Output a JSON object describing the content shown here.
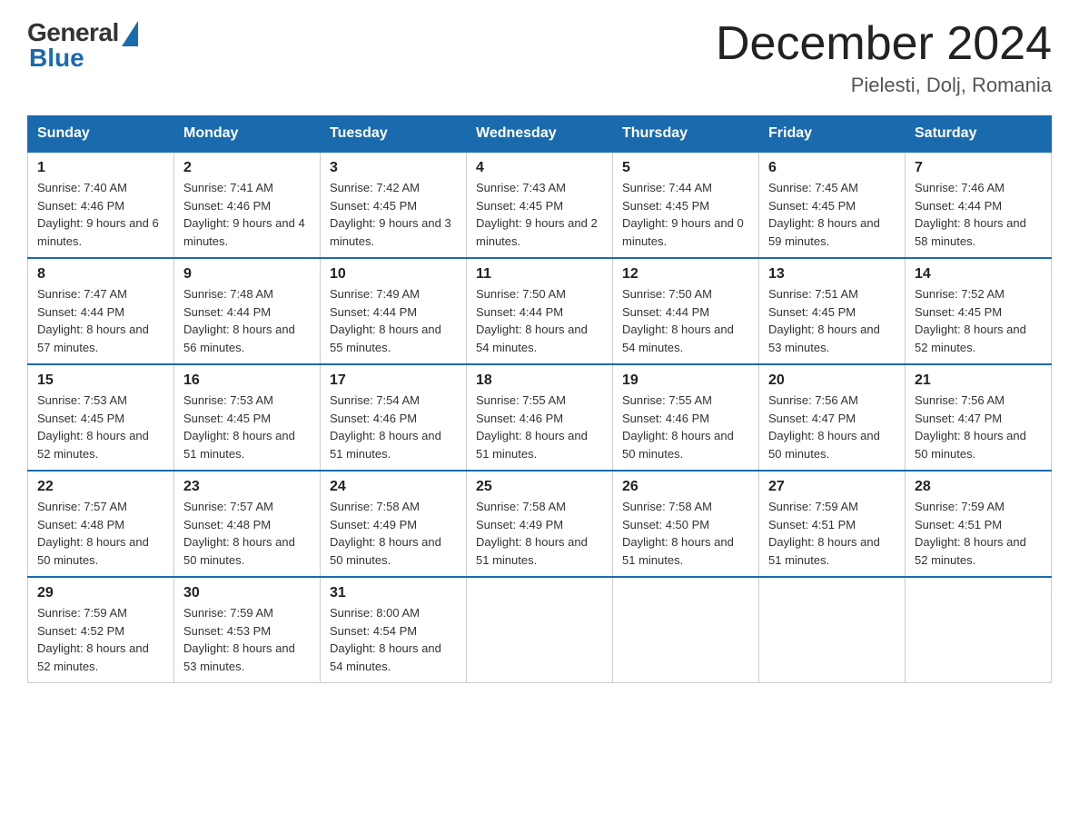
{
  "logo": {
    "general": "General",
    "blue": "Blue"
  },
  "title": "December 2024",
  "subtitle": "Pielesti, Dolj, Romania",
  "days_of_week": [
    "Sunday",
    "Monday",
    "Tuesday",
    "Wednesday",
    "Thursday",
    "Friday",
    "Saturday"
  ],
  "weeks": [
    [
      {
        "day": "1",
        "sunrise": "7:40 AM",
        "sunset": "4:46 PM",
        "daylight": "9 hours and 6 minutes."
      },
      {
        "day": "2",
        "sunrise": "7:41 AM",
        "sunset": "4:46 PM",
        "daylight": "9 hours and 4 minutes."
      },
      {
        "day": "3",
        "sunrise": "7:42 AM",
        "sunset": "4:45 PM",
        "daylight": "9 hours and 3 minutes."
      },
      {
        "day": "4",
        "sunrise": "7:43 AM",
        "sunset": "4:45 PM",
        "daylight": "9 hours and 2 minutes."
      },
      {
        "day": "5",
        "sunrise": "7:44 AM",
        "sunset": "4:45 PM",
        "daylight": "9 hours and 0 minutes."
      },
      {
        "day": "6",
        "sunrise": "7:45 AM",
        "sunset": "4:45 PM",
        "daylight": "8 hours and 59 minutes."
      },
      {
        "day": "7",
        "sunrise": "7:46 AM",
        "sunset": "4:44 PM",
        "daylight": "8 hours and 58 minutes."
      }
    ],
    [
      {
        "day": "8",
        "sunrise": "7:47 AM",
        "sunset": "4:44 PM",
        "daylight": "8 hours and 57 minutes."
      },
      {
        "day": "9",
        "sunrise": "7:48 AM",
        "sunset": "4:44 PM",
        "daylight": "8 hours and 56 minutes."
      },
      {
        "day": "10",
        "sunrise": "7:49 AM",
        "sunset": "4:44 PM",
        "daylight": "8 hours and 55 minutes."
      },
      {
        "day": "11",
        "sunrise": "7:50 AM",
        "sunset": "4:44 PM",
        "daylight": "8 hours and 54 minutes."
      },
      {
        "day": "12",
        "sunrise": "7:50 AM",
        "sunset": "4:44 PM",
        "daylight": "8 hours and 54 minutes."
      },
      {
        "day": "13",
        "sunrise": "7:51 AM",
        "sunset": "4:45 PM",
        "daylight": "8 hours and 53 minutes."
      },
      {
        "day": "14",
        "sunrise": "7:52 AM",
        "sunset": "4:45 PM",
        "daylight": "8 hours and 52 minutes."
      }
    ],
    [
      {
        "day": "15",
        "sunrise": "7:53 AM",
        "sunset": "4:45 PM",
        "daylight": "8 hours and 52 minutes."
      },
      {
        "day": "16",
        "sunrise": "7:53 AM",
        "sunset": "4:45 PM",
        "daylight": "8 hours and 51 minutes."
      },
      {
        "day": "17",
        "sunrise": "7:54 AM",
        "sunset": "4:46 PM",
        "daylight": "8 hours and 51 minutes."
      },
      {
        "day": "18",
        "sunrise": "7:55 AM",
        "sunset": "4:46 PM",
        "daylight": "8 hours and 51 minutes."
      },
      {
        "day": "19",
        "sunrise": "7:55 AM",
        "sunset": "4:46 PM",
        "daylight": "8 hours and 50 minutes."
      },
      {
        "day": "20",
        "sunrise": "7:56 AM",
        "sunset": "4:47 PM",
        "daylight": "8 hours and 50 minutes."
      },
      {
        "day": "21",
        "sunrise": "7:56 AM",
        "sunset": "4:47 PM",
        "daylight": "8 hours and 50 minutes."
      }
    ],
    [
      {
        "day": "22",
        "sunrise": "7:57 AM",
        "sunset": "4:48 PM",
        "daylight": "8 hours and 50 minutes."
      },
      {
        "day": "23",
        "sunrise": "7:57 AM",
        "sunset": "4:48 PM",
        "daylight": "8 hours and 50 minutes."
      },
      {
        "day": "24",
        "sunrise": "7:58 AM",
        "sunset": "4:49 PM",
        "daylight": "8 hours and 50 minutes."
      },
      {
        "day": "25",
        "sunrise": "7:58 AM",
        "sunset": "4:49 PM",
        "daylight": "8 hours and 51 minutes."
      },
      {
        "day": "26",
        "sunrise": "7:58 AM",
        "sunset": "4:50 PM",
        "daylight": "8 hours and 51 minutes."
      },
      {
        "day": "27",
        "sunrise": "7:59 AM",
        "sunset": "4:51 PM",
        "daylight": "8 hours and 51 minutes."
      },
      {
        "day": "28",
        "sunrise": "7:59 AM",
        "sunset": "4:51 PM",
        "daylight": "8 hours and 52 minutes."
      }
    ],
    [
      {
        "day": "29",
        "sunrise": "7:59 AM",
        "sunset": "4:52 PM",
        "daylight": "8 hours and 52 minutes."
      },
      {
        "day": "30",
        "sunrise": "7:59 AM",
        "sunset": "4:53 PM",
        "daylight": "8 hours and 53 minutes."
      },
      {
        "day": "31",
        "sunrise": "8:00 AM",
        "sunset": "4:54 PM",
        "daylight": "8 hours and 54 minutes."
      },
      null,
      null,
      null,
      null
    ]
  ],
  "labels": {
    "sunrise": "Sunrise: ",
    "sunset": "Sunset: ",
    "daylight": "Daylight: "
  }
}
